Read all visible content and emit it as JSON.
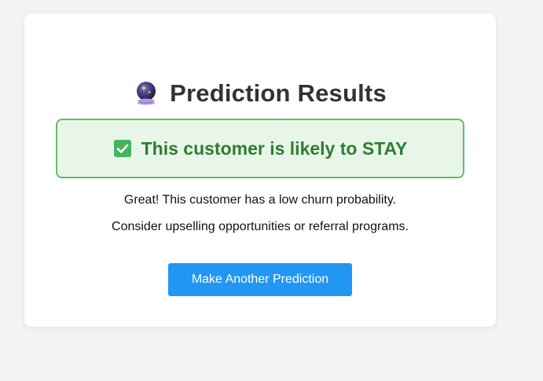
{
  "header": {
    "title": "Prediction Results",
    "icon": "crystal-ball-icon"
  },
  "result": {
    "icon": "check-mark-button-icon",
    "text": "This customer is likely to STAY",
    "colors": {
      "background": "#e8f5e9",
      "border": "#66bb6a",
      "text": "#2e7d32"
    }
  },
  "messages": {
    "line1": "Great! This customer has a low churn probability.",
    "line2": "Consider upselling opportunities or referral programs."
  },
  "actions": {
    "primary_label": "Make Another Prediction",
    "primary_color": "#2196f3"
  }
}
